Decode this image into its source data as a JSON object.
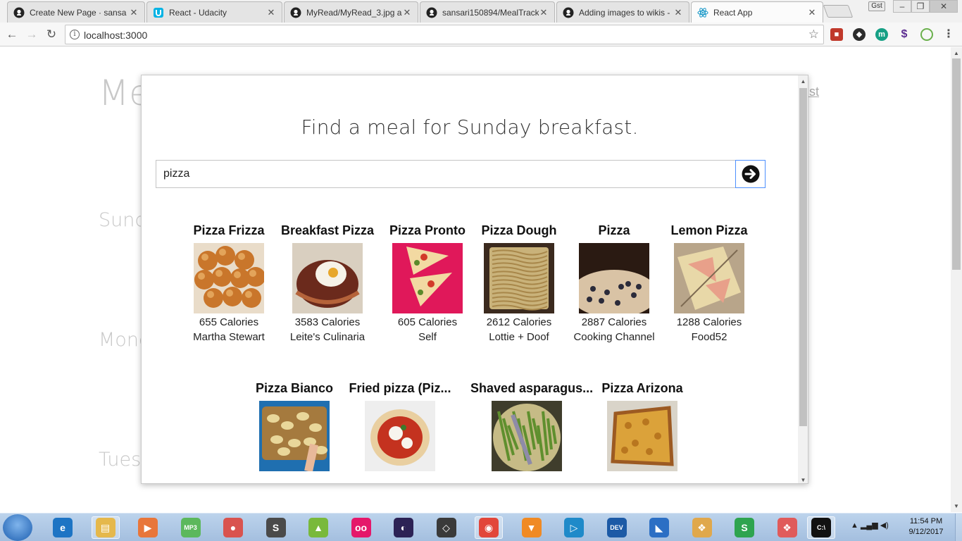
{
  "browser": {
    "tabs": [
      {
        "title": "Create New Page · sansa",
        "icon": "github-icon",
        "active": false
      },
      {
        "title": "React - Udacity",
        "icon": "udacity-icon",
        "active": false
      },
      {
        "title": "MyRead/MyRead_3.jpg a",
        "icon": "github-icon",
        "active": false
      },
      {
        "title": "sansari150894/MealTrack",
        "icon": "github-icon",
        "active": false
      },
      {
        "title": "Adding images to wikis -",
        "icon": "github-icon",
        "active": false
      },
      {
        "title": "React App",
        "icon": "react-icon",
        "active": true
      }
    ],
    "profile_label": "Gst",
    "url": "localhost:3000"
  },
  "page": {
    "title": "Me",
    "link": "ng List",
    "days": [
      "Sund",
      "Mond",
      "Tues"
    ]
  },
  "modal": {
    "heading": "Find a meal for Sunday breakfast.",
    "search": {
      "value": "pizza",
      "placeholder": ""
    },
    "results": [
      {
        "name": "Pizza Frizza",
        "calories": "655 Calories",
        "source": "Martha Stewart",
        "image": "fried-dough-balls"
      },
      {
        "name": "Breakfast Pizza",
        "calories": "3583 Calories",
        "source": "Leite's Culinaria",
        "image": "egg-pizza"
      },
      {
        "name": "Pizza Pronto",
        "calories": "605 Calories",
        "source": "Self",
        "image": "pizza-slices-pink"
      },
      {
        "name": "Pizza Dough",
        "calories": "2612 Calories",
        "source": "Lottie + Doof",
        "image": "sheet-pizza"
      },
      {
        "name": "Pizza",
        "calories": "2887 Calories",
        "source": "Cooking Channel",
        "image": "dark-pizza"
      },
      {
        "name": "Lemon Pizza",
        "calories": "1288 Calories",
        "source": "Food52",
        "image": "lemon-pizza"
      },
      {
        "name": "Pizza Bianco",
        "calories": "",
        "source": "",
        "image": "pizza-bianco"
      },
      {
        "name": "Fried pizza (Piz...",
        "calories": "",
        "source": "",
        "image": "fried-pizza"
      },
      {
        "name": "Shaved asparagus...",
        "calories": "",
        "source": "",
        "image": "asparagus-pizza"
      },
      {
        "name": "Pizza Arizona",
        "calories": "",
        "source": "",
        "image": "pizza-arizona"
      }
    ]
  },
  "taskbar": {
    "apps": [
      "windows-explorer",
      "internet-explorer",
      "file-explorer",
      "media-player",
      "mp3-app",
      "camera-app",
      "sublime-text",
      "android-studio",
      "flickr-app",
      "eclipse",
      "unity",
      "chrome",
      "vlc",
      "video-app",
      "dev-cpp",
      "visual-studio",
      "app-grid",
      "wps-spreadsheets",
      "app-grid-2",
      "cmd"
    ],
    "time": "11:54 PM",
    "date": "9/12/2017"
  }
}
